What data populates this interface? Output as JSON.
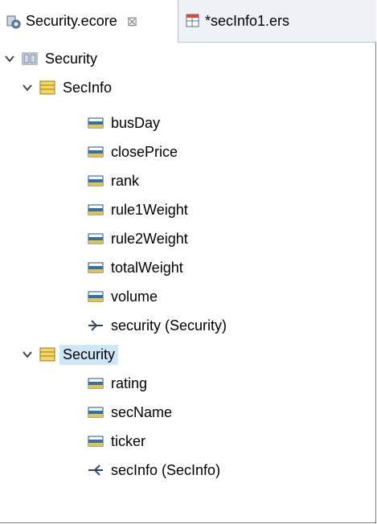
{
  "tabs": [
    {
      "label": "Security.ecore",
      "icon": "ecore-model-icon",
      "active": true,
      "close": "⊠"
    },
    {
      "label": "*secInfo1.ers",
      "icon": "ers-table-icon",
      "active": false
    }
  ],
  "tree": {
    "root": {
      "label": "Security",
      "icon": "package-icon"
    },
    "classes": [
      {
        "label": "SecInfo",
        "attributes": [
          "busDay",
          "closePrice",
          "rank",
          "rule1Weight",
          "rule2Weight",
          "totalWeight",
          "volume"
        ],
        "references": [
          {
            "label": "security (Security)",
            "direction": "outgoing"
          }
        ]
      },
      {
        "label": "Security",
        "selected": true,
        "attributes": [
          "rating",
          "secName",
          "ticker"
        ],
        "references": [
          {
            "label": "secInfo (SecInfo)",
            "direction": "incoming"
          }
        ]
      }
    ]
  },
  "colors": {
    "class_icon": "#e8c43a",
    "attr_icon": "#2f6fb8",
    "selection": "#cfe6f7"
  }
}
